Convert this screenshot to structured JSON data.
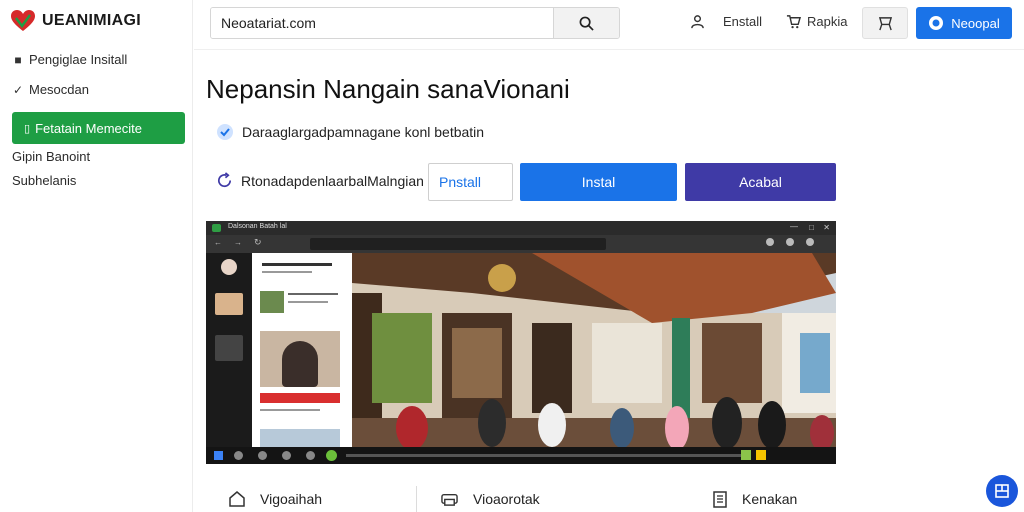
{
  "brand": {
    "name": "UEANIMIAGI"
  },
  "sidebar": {
    "items": [
      {
        "label": "Pengiglae Insitall",
        "icon": "square-icon"
      },
      {
        "label": "Mesocdan",
        "icon": "check-icon"
      },
      {
        "label": "Fetatain Memecite",
        "icon": "doc-icon",
        "active": true
      },
      {
        "label": "Gipin Banoint",
        "icon": ""
      },
      {
        "label": "Subhelanis",
        "icon": ""
      }
    ]
  },
  "topbar": {
    "search_value": "Neoatariat.com",
    "links": [
      {
        "label": "Enstall",
        "icon": "person-icon"
      },
      {
        "label": "Rapkia",
        "icon": "cart-icon"
      }
    ],
    "primary_label": "Neoopal"
  },
  "main": {
    "title": "Nepansin Nangain sanaVionani",
    "row1_text": "Daraaglargadpamnagane konl betbatin",
    "row2_text": "RtonadapdenlaarbalMalngian",
    "install_input_value": "Pnstall",
    "install_button": "Instal",
    "cancel_button": "Acabal"
  },
  "preview": {
    "window_title": "Dalsonan Batah lal"
  },
  "bottom": {
    "items": [
      {
        "label": "Vigoaihah",
        "icon": "home-icon"
      },
      {
        "label": "Vioaorotak",
        "icon": "printer-icon"
      },
      {
        "label": "Kenakan",
        "icon": "document-icon"
      }
    ]
  },
  "colors": {
    "accent_green": "#1e9e44",
    "primary_blue": "#1a73e8",
    "indigo": "#3f3aa6"
  }
}
